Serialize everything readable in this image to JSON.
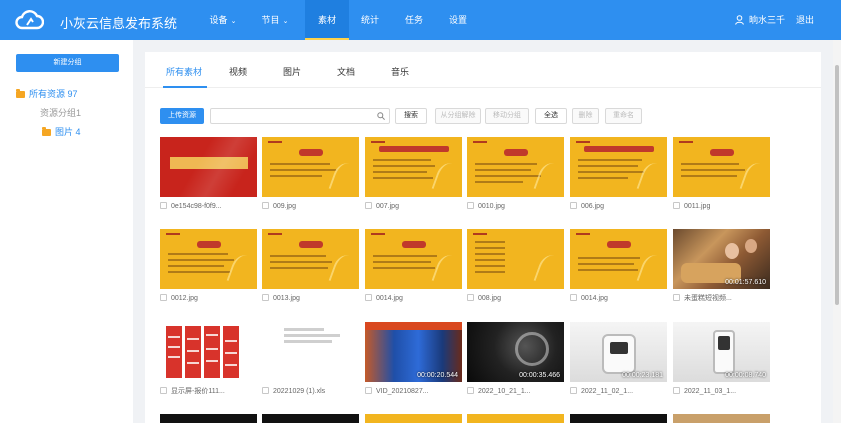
{
  "header": {
    "brand": "小灰云信息发布系统",
    "nav": [
      {
        "label": "设备",
        "dropdown": "⌄"
      },
      {
        "label": "节目",
        "dropdown": "⌄"
      },
      {
        "label": "素材",
        "dropdown": ""
      },
      {
        "label": "统计",
        "dropdown": ""
      },
      {
        "label": "任务",
        "dropdown": ""
      },
      {
        "label": "设置",
        "dropdown": ""
      }
    ],
    "active_nav": "素材",
    "user_name": "晌水三千",
    "logout": "退出"
  },
  "sidebar": {
    "new_group": "新建分组",
    "tree": {
      "root_label": "所有资源",
      "root_count": "97",
      "group_label": "资源分组1",
      "child_label": "图片",
      "child_count": "4"
    }
  },
  "tabs": [
    "所有素材",
    "视频",
    "图片",
    "文档",
    "音乐"
  ],
  "active_tab": "所有素材",
  "toolbar": {
    "upload": "上传资源",
    "search_placeholder": "",
    "search": "搜索",
    "remove_from_group": "从分组解除",
    "move_group": "移动分组",
    "select_all": "全选",
    "delete": "删除",
    "rename": "重命名"
  },
  "assets": [
    {
      "name": "0e154c98-f0f9...",
      "kind": "red-slide"
    },
    {
      "name": "009.jpg",
      "kind": "yellow-slide"
    },
    {
      "name": "007.jpg",
      "kind": "yellow-slide"
    },
    {
      "name": "0010.jpg",
      "kind": "yellow-slide"
    },
    {
      "name": "006.jpg",
      "kind": "yellow-slide"
    },
    {
      "name": "0011.jpg",
      "kind": "yellow-slide"
    },
    {
      "name": "0012.jpg",
      "kind": "yellow-slide"
    },
    {
      "name": "0013.jpg",
      "kind": "yellow-slide"
    },
    {
      "name": "0014.jpg",
      "kind": "yellow-slide"
    },
    {
      "name": "008.jpg",
      "kind": "yellow-slide"
    },
    {
      "name": "0014.jpg",
      "kind": "yellow-slide"
    },
    {
      "name": "未蛋糕短视频...",
      "kind": "video",
      "duration": "00:01:57.610"
    },
    {
      "name": "显示屏-报价111...",
      "kind": "document"
    },
    {
      "name": "20221029 (1).xls",
      "kind": "spreadsheet"
    },
    {
      "name": "VID_20210827...",
      "kind": "video",
      "duration": "00:00:20.544"
    },
    {
      "name": "2022_10_21_1...",
      "kind": "video",
      "duration": "00:00:35.466"
    },
    {
      "name": "2022_11_02_1...",
      "kind": "video",
      "duration": "00:00:23.181"
    },
    {
      "name": "2022_11_03_1...",
      "kind": "video",
      "duration": "00:00:08.740"
    }
  ]
}
